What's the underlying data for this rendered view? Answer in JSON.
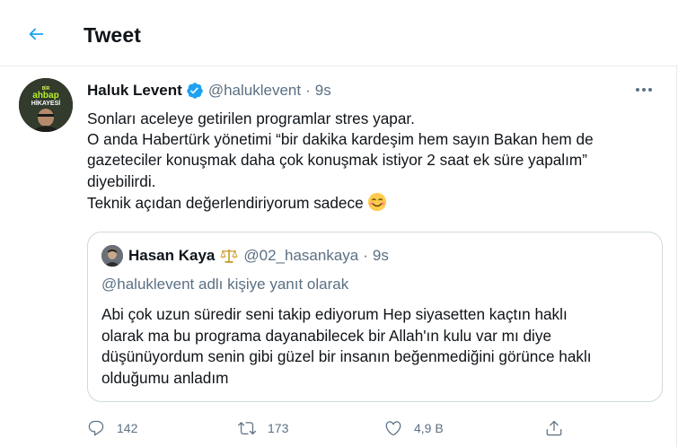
{
  "header": {
    "title": "Tweet"
  },
  "tweet": {
    "author_name": "Haluk Levent",
    "handle": "@haluklevent",
    "separator": "·",
    "time": "9s",
    "body_lines": [
      "Sonları aceleye getirilen programlar stres yapar.",
      "O anda Habertürk yönetimi “bir dakika kardeşim hem sayın Bakan hem de",
      "gazeteciler konuşmak daha çok konuşmak istiyor 2 saat ek süre yapalım”",
      "diyebilirdi.",
      "Teknik açıdan değerlendiriyorum sadece"
    ],
    "avatar_text": [
      "BİR",
      "ahbap",
      "HİKAYESİ"
    ]
  },
  "quote": {
    "author_name": "Hasan Kaya",
    "handle": "@02_hasankaya",
    "separator": "·",
    "time": "9s",
    "reply_to": "@haluklevent adlı kişiye yanıt olarak",
    "body_lines": [
      "Abi çok uzun süredir seni takip ediyorum Hep siyasetten kaçtın haklı",
      "olarak ma bu programa dayanabilecek bir Allah'ın kulu var mı diye",
      "düşünüyordum senin gibi güzel bir insanın beğenmediğini görünce haklı",
      "olduğumu anladım"
    ]
  },
  "actions": {
    "reply_count": "142",
    "retweet_count": "173",
    "like_count": "4,9 B"
  },
  "colors": {
    "accent": "#1da1f2",
    "secondary_text": "#5b7083",
    "border": "#e6ecf0"
  }
}
